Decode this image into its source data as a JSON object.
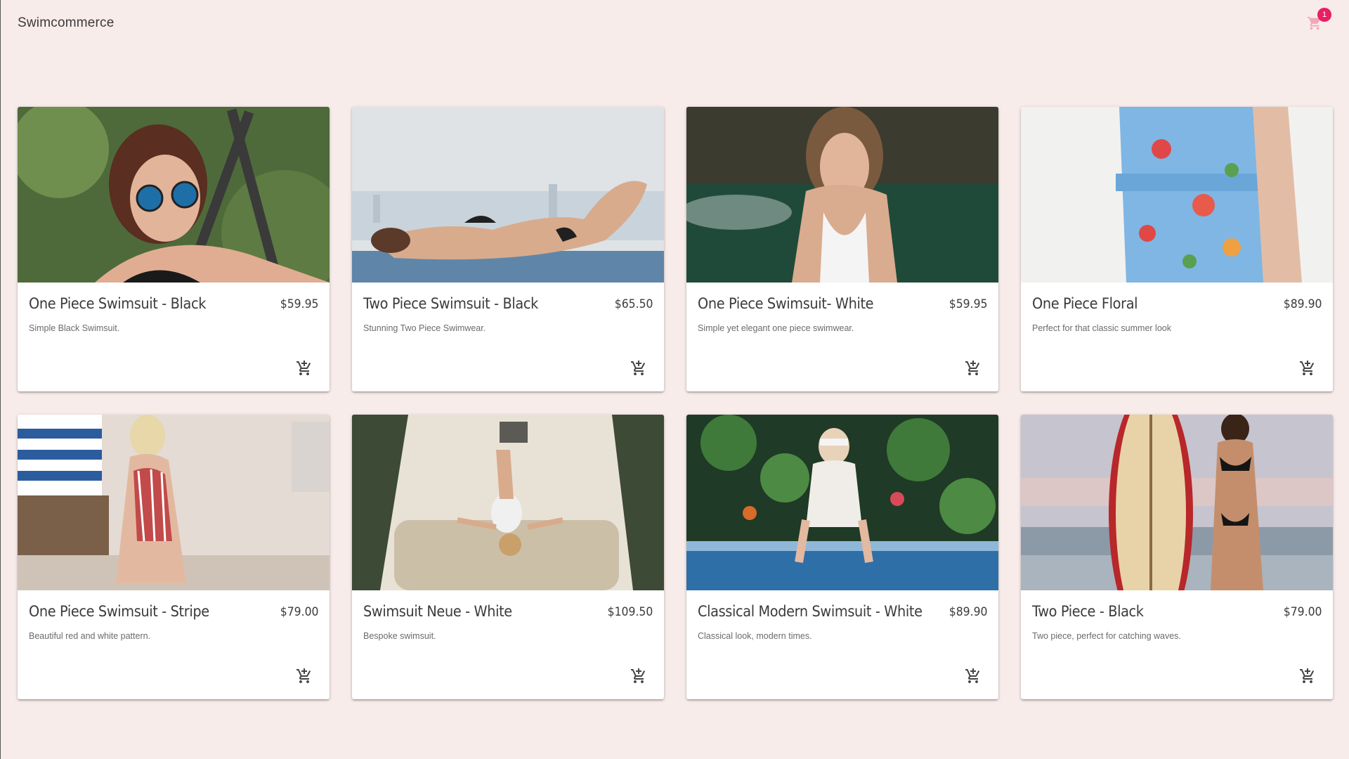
{
  "app": {
    "title": "Swimcommerce"
  },
  "cart": {
    "count": "1"
  },
  "colors": {
    "background": "#f8eceb",
    "badge": "#e91e63",
    "card": "#ffffff"
  },
  "products": [
    {
      "name": "One Piece Swimsuit - Black",
      "price": "$59.95",
      "description": "Simple Black Swimsuit."
    },
    {
      "name": "Two Piece Swimsuit - Black",
      "price": "$65.50",
      "description": "Stunning Two Piece Swimwear."
    },
    {
      "name": "One Piece Swimsuit- White",
      "price": "$59.95",
      "description": "Simple yet elegant one piece swimwear."
    },
    {
      "name": "One Piece Floral",
      "price": "$89.90",
      "description": "Perfect for that classic summer look"
    },
    {
      "name": "One Piece Swimsuit - Stripe",
      "price": "$79.00",
      "description": "Beautiful red and white pattern."
    },
    {
      "name": "Swimsuit Neue - White",
      "price": "$109.50",
      "description": "Bespoke swimsuit."
    },
    {
      "name": "Classical Modern Swimsuit - White",
      "price": "$89.90",
      "description": "Classical look, modern times."
    },
    {
      "name": "Two Piece - Black",
      "price": "$79.00",
      "description": "Two piece, perfect for catching waves."
    }
  ]
}
